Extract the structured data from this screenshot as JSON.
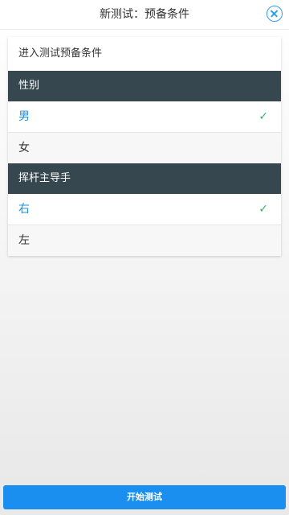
{
  "header": {
    "title": "新测试：预备条件",
    "close_icon": "close-circle-icon",
    "accent_color": "#2f9fe8"
  },
  "card": {
    "title": "进入测试预备条件",
    "sections": [
      {
        "header": "性别",
        "options": [
          {
            "label": "男",
            "selected": true
          },
          {
            "label": "女",
            "selected": false
          }
        ]
      },
      {
        "header": "挥杆主导手",
        "options": [
          {
            "label": "右",
            "selected": true
          },
          {
            "label": "左",
            "selected": false
          }
        ]
      }
    ],
    "check_glyph": "✓",
    "check_icon": "checkmark-icon",
    "check_color": "#32b464",
    "selected_color": "#1f8fe0",
    "section_header_color": "#37474f"
  },
  "footer": {
    "start_label": "开始测试",
    "button_color": "#1b8ff0"
  }
}
